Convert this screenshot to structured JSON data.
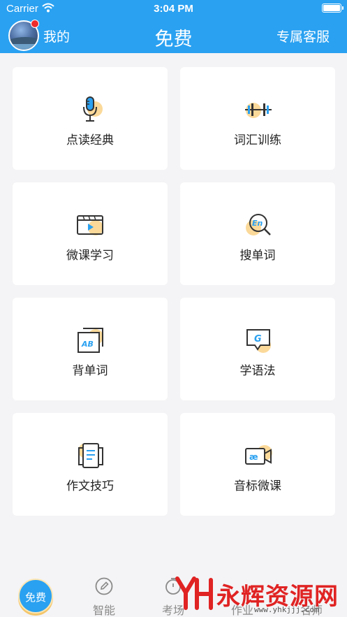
{
  "status": {
    "carrier": "Carrier",
    "time": "3:04 PM"
  },
  "nav": {
    "mine_label": "我的",
    "title": "免费",
    "service_label": "专属客服"
  },
  "cards": [
    {
      "label": "点读经典",
      "icon": "microphone-icon"
    },
    {
      "label": "词汇训练",
      "icon": "dumbbell-icon"
    },
    {
      "label": "微课学习",
      "icon": "video-player-icon"
    },
    {
      "label": "搜单词",
      "icon": "search-en-icon"
    },
    {
      "label": "背单词",
      "icon": "ab-cards-icon"
    },
    {
      "label": "学语法",
      "icon": "grammar-bubble-icon"
    },
    {
      "label": "作文技巧",
      "icon": "document-icon"
    },
    {
      "label": "音标微课",
      "icon": "phonetic-camera-icon"
    }
  ],
  "tabs": {
    "free": "免费",
    "smart": "智能",
    "exam": "考场",
    "homework": "作业",
    "teacher": "名师"
  },
  "watermark": {
    "text": "永辉资源网",
    "url": "www.yhkjjj.com"
  },
  "colors": {
    "primary": "#2aa1f1",
    "accent_circle": "#fbd999",
    "badge": "#ee2b2b"
  }
}
